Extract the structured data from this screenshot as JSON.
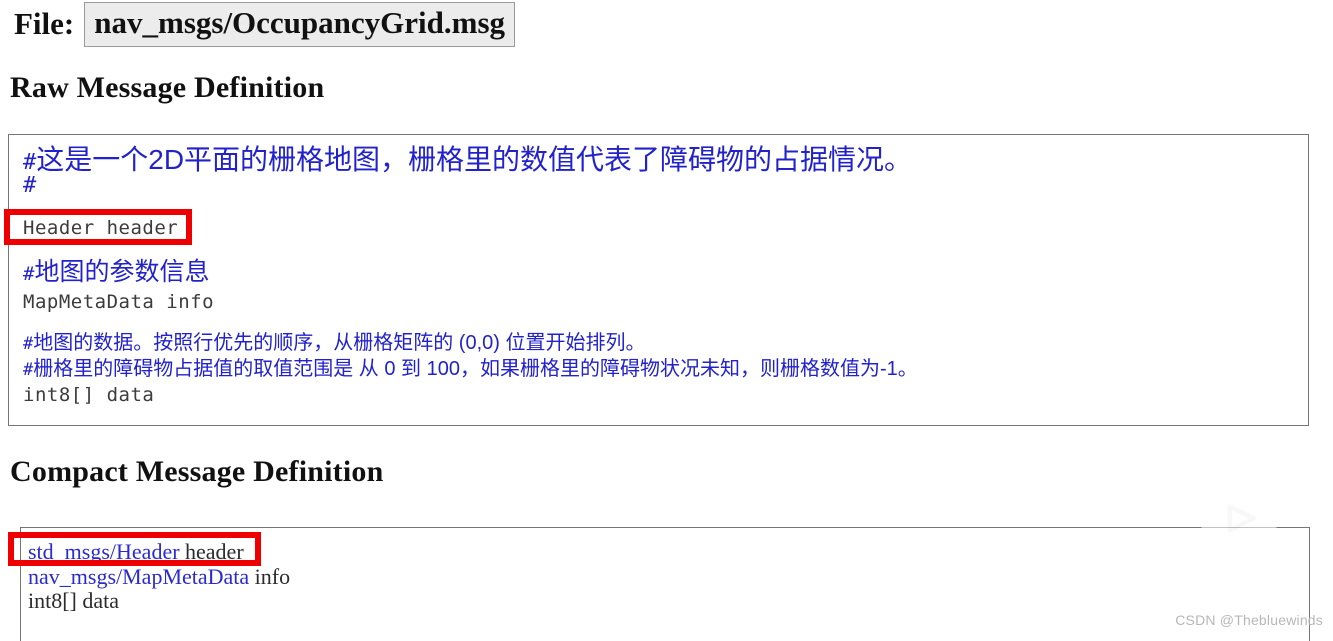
{
  "file": {
    "label": "File:",
    "value": "nav_msgs/OccupancyGrid.msg"
  },
  "headings": {
    "raw": "Raw Message Definition",
    "compact": "Compact Message Definition"
  },
  "raw_definition": {
    "comment_intro_hash": "#",
    "comment_intro_hash_second": "#",
    "comment_intro": "这是一个2D平面的栅格地图，栅格里的数值代表了障碍物的占据情况。",
    "field_header": "Header header",
    "comment_mapmeta_hash": "#",
    "comment_mapmeta": "地图的参数信息",
    "field_mapmeta": "MapMetaData info",
    "comment_data1_hash": "#",
    "comment_data1": "地图的数据。按照行优先的顺序，从栅格矩阵的 (0,0) 位置开始排列。",
    "comment_data2_hash": "#",
    "comment_data2": "栅格里的障碍物占据值的取值范围是 从 0 到 100，如果栅格里的障碍物状况未知，则栅格数值为-1。",
    "field_data": "int8[] data"
  },
  "compact_definition": {
    "rows": [
      {
        "link": "std_msgs/Header",
        "rest": " header"
      },
      {
        "link": "nav_msgs/MapMetaData",
        "rest": " info"
      },
      {
        "link": "",
        "rest": "int8[] data"
      }
    ]
  },
  "annotations": {
    "red_box_color": "#ee0000",
    "highlight_header": "Header header",
    "highlight_std_header": "std_msgs/Header header"
  },
  "watermarks": {
    "bilibili_icon": "bilibili-tv-play-icon",
    "csdn": "CSDN @Thebluewinds"
  },
  "colors": {
    "comment_blue": "#2222cc",
    "link_blue": "#2a2ad0",
    "mono_gray": "#3c3c3c",
    "panel_border": "#767676",
    "file_box_bg": "#ececec"
  }
}
